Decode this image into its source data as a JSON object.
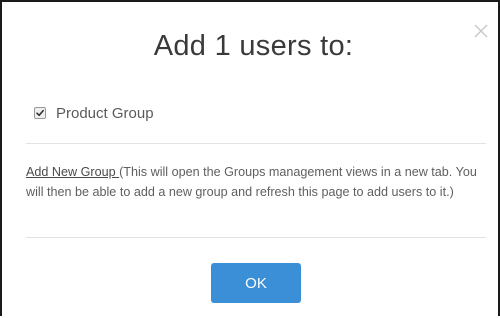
{
  "dialog": {
    "title": "Add 1 users to:",
    "close_icon": "close-icon",
    "groups": [
      {
        "label": "Product Group",
        "checked": true
      }
    ],
    "add_group_link": "Add New Group ",
    "add_group_note": "(This will open the Groups management views in a new tab. You will then be able to add a new group and refresh this page to add users to it.)",
    "ok_label": "OK",
    "accent_color": "#3b8fd6"
  }
}
